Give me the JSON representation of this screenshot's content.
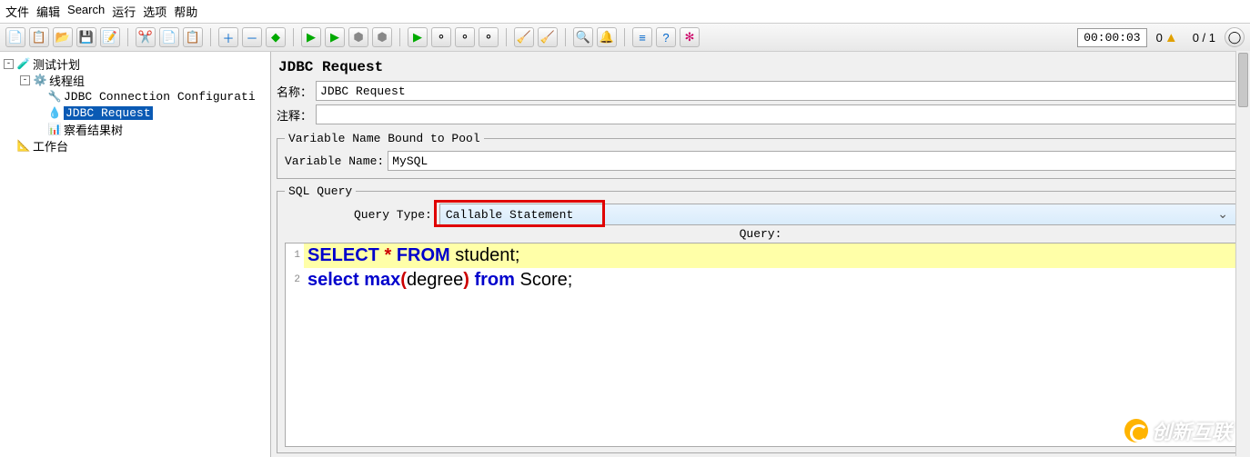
{
  "menu": [
    "文件",
    "编辑",
    "Search",
    "运行",
    "选项",
    "帮助"
  ],
  "status": {
    "time": "00:00:03",
    "c1": "0",
    "c2": "0 / 1"
  },
  "tree": {
    "root": "测试计划",
    "thread": "线程组",
    "jdbc_conf": "JDBC Connection Configurati",
    "jdbc_req": "JDBC Request",
    "results": "察看结果树",
    "workbench": "工作台"
  },
  "panel": {
    "title": "JDBC Request",
    "name_label": "名称：",
    "name_value": "JDBC Request",
    "comment_label": "注释：",
    "comment_value": "",
    "var_fieldset": "Variable Name Bound to Pool",
    "var_label": "Variable Name:",
    "var_value": "MySQL",
    "sql_fieldset": "SQL Query",
    "qtype_label": "Query Type:",
    "qtype_value": "Callable Statement",
    "query_label": "Query:"
  },
  "chart_data": {
    "type": "table",
    "title": "SQL Query",
    "rows": [
      {
        "n": 1,
        "sql": "SELECT * FROM student;",
        "highlight": true
      },
      {
        "n": 2,
        "sql": "select max(degree) from Score;",
        "highlight": false
      }
    ]
  },
  "watermark": "创新互联"
}
